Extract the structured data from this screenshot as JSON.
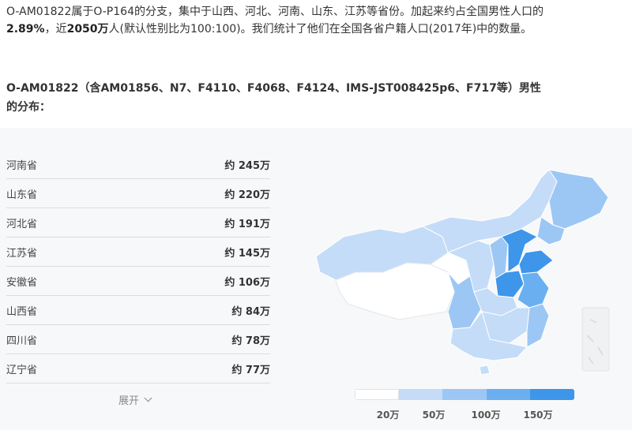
{
  "intro": {
    "part1": "O-AM01822属于O-P164的分支，集中于山西、河北、河南、山东、江苏等省份。加起来约占全国男性人口的",
    "percent": "2.89%",
    "part2": "，近",
    "count": "2050万",
    "part3": "人(默认性别比为100:100)。我们统计了他们在全国各省户籍人口(2017年)中的数量。"
  },
  "section_title": "O-AM01822（含AM01856、N7、F4110、F4068、F4124、IMS-JST008425p6、F717等）男性的分布：",
  "table": {
    "rows": [
      {
        "name": "河南省",
        "value": "约 245万"
      },
      {
        "name": "山东省",
        "value": "约 220万"
      },
      {
        "name": "河北省",
        "value": "约 191万"
      },
      {
        "name": "江苏省",
        "value": "约 145万"
      },
      {
        "name": "安徽省",
        "value": "约 106万"
      },
      {
        "name": "山西省",
        "value": "约 84万"
      },
      {
        "name": "四川省",
        "value": "约 78万"
      },
      {
        "name": "辽宁省",
        "value": "约 77万"
      }
    ],
    "expand_label": "展开"
  },
  "legend": {
    "colors": [
      "#ffffff",
      "#c4dcf8",
      "#9cc7f5",
      "#6ab0f0",
      "#3d96ea"
    ],
    "labels": [
      "20万",
      "50万",
      "100万",
      "150万"
    ]
  },
  "map": {
    "icon": "china-map-icon"
  }
}
